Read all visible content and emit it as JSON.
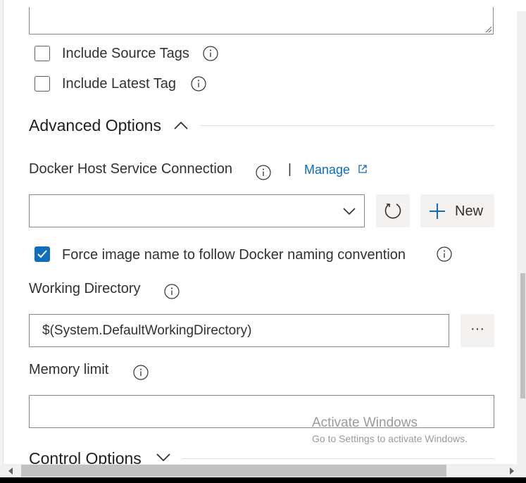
{
  "options": {
    "include_source_tags": {
      "label": "Include Source Tags",
      "checked": false
    },
    "include_latest_tag": {
      "label": "Include Latest Tag",
      "checked": false
    }
  },
  "advanced": {
    "title": "Advanced Options",
    "docker_host": {
      "label": "Docker Host Service Connection",
      "separator": "|",
      "manage_label": "Manage",
      "selected_value": "",
      "new_label": "New"
    },
    "force_name": {
      "label": "Force image name to follow Docker naming convention",
      "checked": true
    },
    "working_directory": {
      "label": "Working Directory",
      "value": "$(System.DefaultWorkingDirectory)",
      "browse_label": "···"
    },
    "memory_limit": {
      "label": "Memory limit",
      "value": ""
    }
  },
  "control": {
    "title": "Control Options"
  },
  "watermark": {
    "title": "Activate Windows",
    "subtitle": "Go to Settings to activate Windows."
  },
  "colors": {
    "accent": "#106ebe",
    "link": "#0f6cbd",
    "border": "#8a8886"
  }
}
